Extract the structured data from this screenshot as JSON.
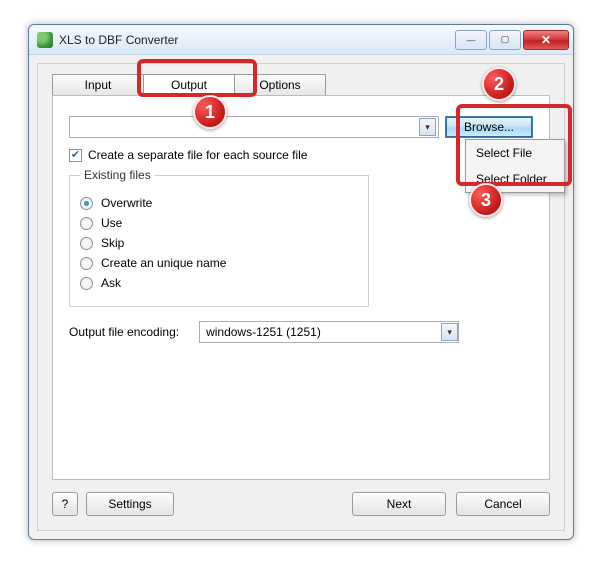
{
  "titlebar": {
    "title": "XLS to DBF Converter"
  },
  "tabs": {
    "input": "Input",
    "output": "Output",
    "options": "Options"
  },
  "output": {
    "browse": "Browse...",
    "separate_file_label": "Create a separate file for each source file",
    "existing_legend": "Existing files",
    "radios": {
      "overwrite": "Overwrite",
      "use": "Use",
      "skip": "Skip",
      "unique": "Create an unique name",
      "ask": "Ask"
    },
    "encoding_label": "Output file encoding:",
    "encoding_value": "windows-1251 (1251)"
  },
  "menu": {
    "select_file": "Select File",
    "select_folder": "Select Folder"
  },
  "buttons": {
    "help": "?",
    "settings": "Settings",
    "next": "Next",
    "cancel": "Cancel"
  },
  "annotations": {
    "b1": "1",
    "b2": "2",
    "b3": "3"
  }
}
